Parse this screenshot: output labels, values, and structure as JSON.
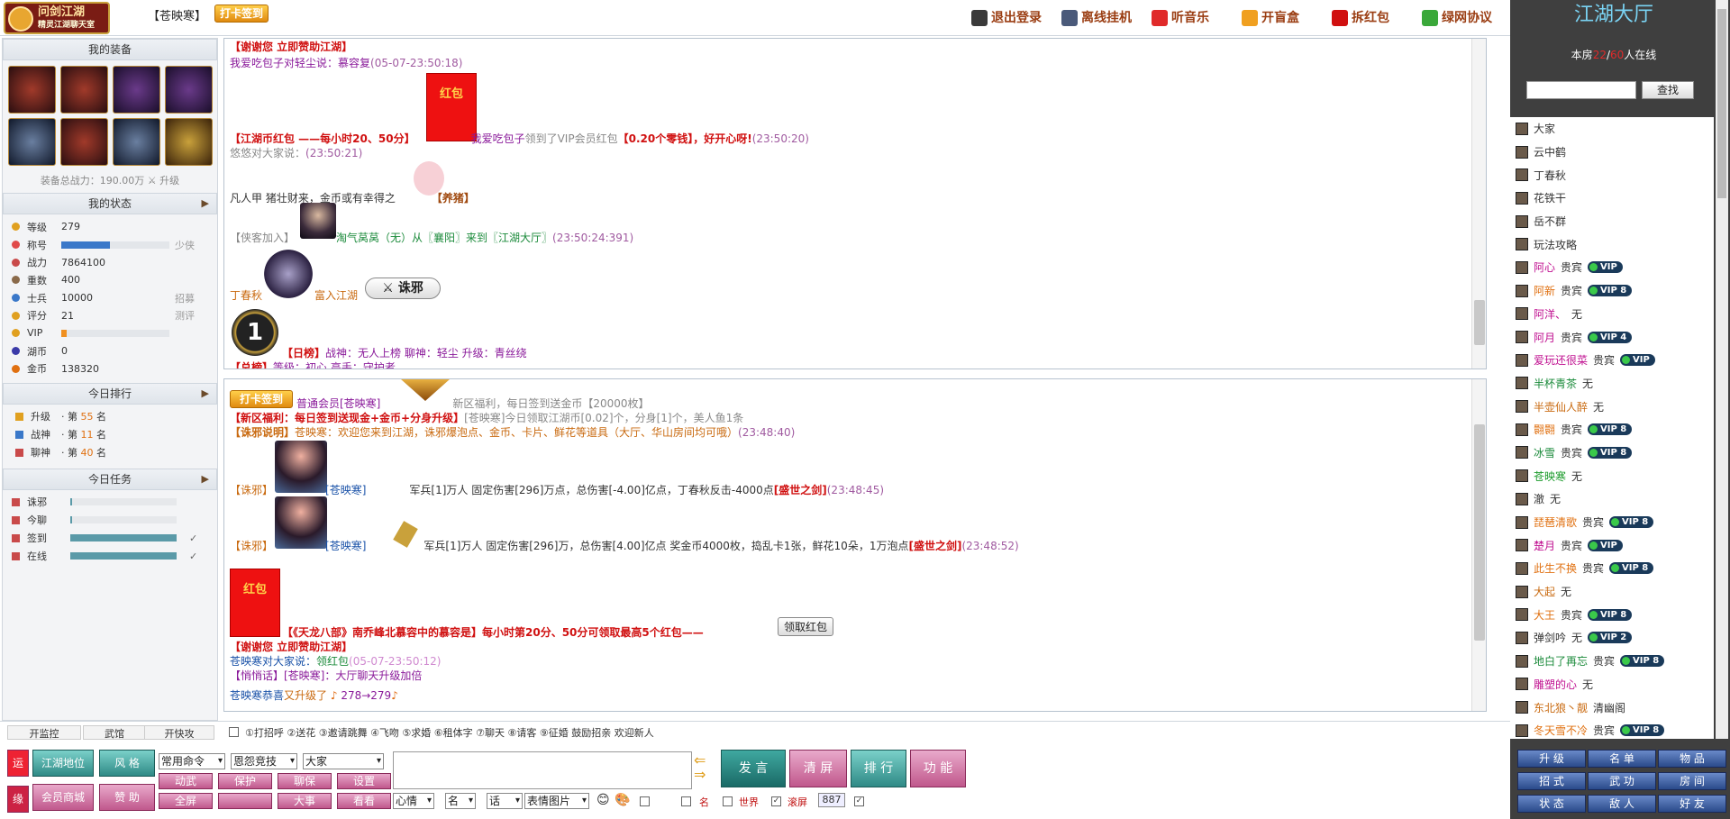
{
  "top": {
    "logo_title": "问剑江湖",
    "logo_sub": "精灵江湖聊天室",
    "room": "【苍映寒】",
    "checkin": "打卡签到",
    "links": [
      "退出登录",
      "离线挂机",
      "听音乐",
      "开盲盒",
      "拆红包",
      "绿网协议"
    ]
  },
  "left": {
    "equip_title": "我的装备",
    "equip_power": "装备总战力：190.00万",
    "equip_upgrade": "升级",
    "status_title": "我的状态",
    "stats": [
      {
        "label": "等级",
        "value": "279",
        "right": "",
        "bar": null
      },
      {
        "label": "称号",
        "value": "",
        "right": "少侠",
        "bar": 0.45
      },
      {
        "label": "战力",
        "value": "7864100",
        "right": "",
        "bar": null
      },
      {
        "label": "重数",
        "value": "400",
        "right": "",
        "bar": null
      },
      {
        "label": "士兵",
        "value": "10000",
        "right": "招募",
        "bar": null
      },
      {
        "label": "评分",
        "value": "21",
        "right": "测评",
        "bar": null
      },
      {
        "label": "VIP",
        "value": "",
        "right": "",
        "bar": 0.05
      },
      {
        "label": "湖币",
        "value": "0",
        "right": "",
        "bar": null
      },
      {
        "label": "金币",
        "value": "138320",
        "right": "",
        "bar": null
      }
    ],
    "rank_title": "今日排行",
    "ranks": [
      {
        "label": "升级",
        "prefix": "· 第",
        "num": "55",
        "suffix": "名"
      },
      {
        "label": "战神",
        "prefix": "· 第",
        "num": "11",
        "suffix": "名"
      },
      {
        "label": "聊神",
        "prefix": "· 第",
        "num": "40",
        "suffix": "名"
      }
    ],
    "task_title": "今日任务",
    "tasks": [
      {
        "label": "诛邪",
        "fill": 0.02,
        "check": ""
      },
      {
        "label": "今聊",
        "fill": 0.02,
        "check": ""
      },
      {
        "label": "签到",
        "fill": 1,
        "check": "✓"
      },
      {
        "label": "在线",
        "fill": 1,
        "check": "✓"
      }
    ]
  },
  "chat1": {
    "l1": "【谢谢您  立即赞助江湖】",
    "l2a": "我爱吃包子对轻尘说：",
    "l2b": "慕容复",
    "l2t": "(05-07-23:50:18)",
    "rp_text": "红包",
    "l3a": "【江湖币红包  ——每小时20、50分】",
    "l3b": "我爱吃包子",
    "l3c": "领到了VIP会员红包",
    "l3d": "【0.20个零钱】，好开心呀!",
    "l3t": "(23:50:20)",
    "l4": "悠悠对大家说：",
    "l4t": "(23:50:21)",
    "l5a": "凡人甲  猪壮财来，金币或有幸得之",
    "l5b": "【养猪】",
    "l6a": "【侠客加入】",
    "l6b": "淘气莴莴（无）从〖襄阳〗来到〖江湖大厅〗",
    "l6t": "(23:50:24:391)",
    "l7a": "丁春秋",
    "l7b": "富入江湖",
    "l7btn": "诛邪",
    "l8a": "【日榜】",
    "l8b": "战神：无人上榜  聊神：轻尘  升级：青丝绕",
    "l9a": "【总榜】",
    "l9b": "等级：初心  高手：守护者"
  },
  "chat2": {
    "checkin": "打卡签到",
    "m1a": "普通会员[苍映寒]",
    "m1b": "新区福利，每日签到送金币【20000枚】",
    "m2a": "【新区福利：每日签到送现金+金币+分身升级】",
    "m2b": "[苍映寒]今日领取江湖币[0.02]个，分身[1]个，美人鱼1条",
    "m3a": "【诛邪说明】",
    "m3b": "苍映寒：欢迎您来到江湖，诛邪爆泡点、金币、卡片、鲜花等道具（大厅、华山房间均可哦）",
    "m3t": "(23:48:40)",
    "m4a": "【诛邪】",
    "m4b": "[苍映寒]",
    "m4c": "军兵[1]万人  固定伤害[296]万点，总伤害[-4.00]亿点，丁春秋反击-4000点",
    "m4d": "[盛世之剑]",
    "m4t": "(23:48:45)",
    "m5a": "【诛邪】",
    "m5b": "[苍映寒]",
    "m5c": "军兵[1]万人  固定伤害[296]万，总伤害[4.00]亿点  奖金币4000枚，捣乱卡1张，鲜花10朵，1万泡点",
    "m5d": "[盛世之剑]",
    "m5t": "(23:48:52)",
    "rp_text": "红包",
    "m6a": "【《天龙八部》南乔峰北慕容中的慕容是】每小时第20分、50分可领取最高5个红包——",
    "m6btn": "领取红包",
    "m7": "【谢谢您  立即赞助江湖】",
    "m8a": "苍映寒对大家说：",
    "m8b": "领红包",
    "m8t": "(05-07-23:50:12)",
    "m9a": "【悄悄话】[苍映寒]：",
    "m9b": "大厅聊天升级加倍",
    "m10a": "苍映寒恭喜",
    "m10b": "又升级了",
    "m10c": "278→279"
  },
  "funcbar": {
    "items": [
      "开监控",
      "武馆",
      "开快攻"
    ],
    "options": "①打招呼  ②送花  ③邀请跳舞  ④飞吻  ⑤求婚  ⑥租体字  ⑦聊天  ⑧请客  ⑨征婚  鼓励招亲  欢迎新人"
  },
  "input": {
    "yun": "运",
    "yuan": "缘",
    "b1": "江湖地位",
    "b2": "风 格",
    "b3": "会员商城",
    "b4": "赞 助",
    "s1": "常用命令",
    "s2": "恩怨竞技",
    "s3": "大家",
    "g1": "动武",
    "g2": "保护",
    "g3": "聊保",
    "g4": "设置",
    "g5": "全屏",
    "g6": "",
    "g7": "大事",
    "g8": "看看",
    "s4": "心情",
    "s5": "名",
    "s6": "话",
    "s7": "表情图片",
    "c1": "",
    "c2": "名",
    "c3": "世界",
    "c4": "滚屏",
    "num": "887",
    "send": "发 言",
    "clear": "清 屏",
    "rank": "排 行",
    "func": "功 能"
  },
  "right": {
    "title": "江湖大厅",
    "online_prefix": "本房",
    "online_a": "22",
    "online_sep": "/",
    "online_b": "60",
    "online_suffix": "人在线",
    "find": "查找",
    "users": [
      {
        "name": "大家",
        "role": "",
        "vip": "",
        "color": "#333"
      },
      {
        "name": "云中鹤",
        "role": "",
        "vip": "",
        "color": "#333"
      },
      {
        "name": "丁春秋",
        "role": "",
        "vip": "",
        "color": "#333"
      },
      {
        "name": "花铁干",
        "role": "",
        "vip": "",
        "color": "#333"
      },
      {
        "name": "岳不群",
        "role": "",
        "vip": "",
        "color": "#333"
      },
      {
        "name": "玩法攻略",
        "role": "",
        "vip": "",
        "color": "#333"
      },
      {
        "name": "阿心",
        "role": "贵宾",
        "vip": "VIP",
        "color": "#c01090"
      },
      {
        "name": "阿新",
        "role": "贵宾",
        "vip": "VIP 8",
        "color": "#e07010"
      },
      {
        "name": "阿洋、",
        "role": "无",
        "vip": "",
        "color": "#c01090"
      },
      {
        "name": "阿月",
        "role": "贵宾",
        "vip": "VIP 4",
        "color": "#c01090"
      },
      {
        "name": "爱玩还很菜",
        "role": "贵宾",
        "vip": "VIP",
        "color": "#c01090"
      },
      {
        "name": "半杯青茶",
        "role": "无",
        "vip": "",
        "color": "#1a8a3a"
      },
      {
        "name": "半壶仙人醉",
        "role": "无",
        "vip": "",
        "color": "#c96a10"
      },
      {
        "name": "翾翾",
        "role": "贵宾",
        "vip": "VIP 8",
        "color": "#e07010"
      },
      {
        "name": "冰雪",
        "role": "贵宾",
        "vip": "VIP 8",
        "color": "#1a8a3a"
      },
      {
        "name": "苍映寒",
        "role": "无",
        "vip": "",
        "color": "#1a9a2a"
      },
      {
        "name": "澈",
        "role": "无",
        "vip": "",
        "color": "#333"
      },
      {
        "name": "琵琶清歌",
        "role": "贵宾",
        "vip": "VIP 8",
        "color": "#e07010"
      },
      {
        "name": "楚月",
        "role": "贵宾",
        "vip": "VIP",
        "color": "#c01090"
      },
      {
        "name": "此生不换",
        "role": "贵宾",
        "vip": "VIP 8",
        "color": "#e07010"
      },
      {
        "name": "大起",
        "role": "无",
        "vip": "",
        "color": "#c96a10"
      },
      {
        "name": "大王",
        "role": "贵宾",
        "vip": "VIP 8",
        "color": "#e07010"
      },
      {
        "name": "弹剑吟",
        "role": "无",
        "vip": "VIP 2",
        "color": "#333"
      },
      {
        "name": "地白了再忘",
        "role": "贵宾",
        "vip": "VIP 8",
        "color": "#1a8a3a"
      },
      {
        "name": "雕塑的心",
        "role": "无",
        "vip": "",
        "color": "#c01090"
      },
      {
        "name": "东北狼丶靓",
        "role": "清幽阁",
        "vip": "",
        "color": "#c96a10"
      },
      {
        "name": "冬天雪不冷",
        "role": "贵宾",
        "vip": "VIP 8",
        "color": "#e07010"
      }
    ],
    "grid": [
      "升 级",
      "名 单",
      "物 品",
      "招 式",
      "武 功",
      "房 间",
      "状 态",
      "敌 人",
      "好 友"
    ]
  }
}
